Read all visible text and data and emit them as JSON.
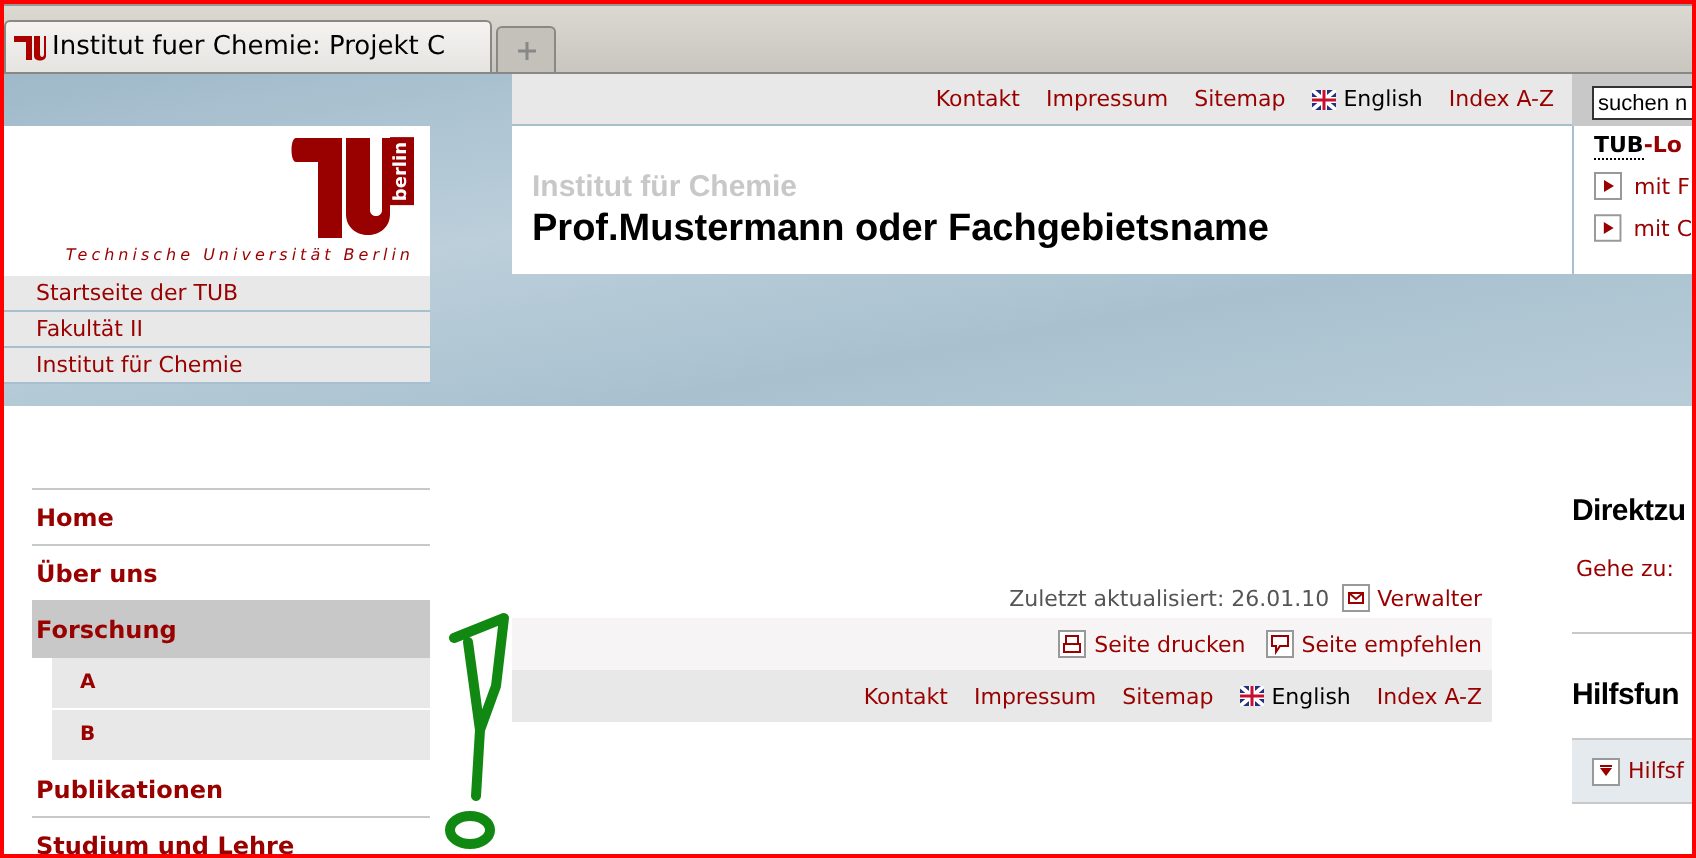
{
  "browser": {
    "tabs": [
      {
        "title": "Institut fuer Chemie: Projekt C",
        "selected": true
      }
    ]
  },
  "header": {
    "logo": {
      "side_text": "berlin",
      "caption": "Technische Universität Berlin"
    },
    "breadcrumbs": [
      "Startseite der TUB",
      "Fakultät II",
      "Institut für Chemie"
    ],
    "top_links": [
      {
        "label": "Kontakt",
        "kind": "link"
      },
      {
        "label": "Impressum",
        "kind": "link"
      },
      {
        "label": "Sitemap",
        "kind": "link"
      },
      {
        "label": "English",
        "kind": "language"
      },
      {
        "label": "Index A-Z",
        "kind": "link"
      }
    ],
    "search": {
      "value": "suchen n"
    },
    "subtitle": "Institut für Chemie",
    "title": "Prof.Mustermann oder Fachgebietsname",
    "login": {
      "abbr": "TUB",
      "rest": "-Lo",
      "links": [
        "mit F",
        "mit C"
      ]
    }
  },
  "nav": [
    {
      "label": "Home",
      "selected": false
    },
    {
      "label": "Über uns",
      "selected": false
    },
    {
      "label": "Forschung",
      "selected": true,
      "children": [
        {
          "label": "A",
          "selected": false
        },
        {
          "label": "B",
          "selected": false
        }
      ]
    },
    {
      "label": "Publikationen",
      "selected": false
    },
    {
      "label": "Studium und Lehre",
      "selected": false
    }
  ],
  "page_info": {
    "updated": "Zuletzt aktualisiert: 26.01.10",
    "maintainer": "Verwalter"
  },
  "actions": [
    {
      "label": "Seite drucken",
      "kind": "print"
    },
    {
      "label": "Seite empfehlen",
      "kind": "recommend"
    }
  ],
  "footer_links": [
    {
      "label": "Kontakt",
      "kind": "link"
    },
    {
      "label": "Impressum",
      "kind": "link"
    },
    {
      "label": "Sitemap",
      "kind": "link"
    },
    {
      "label": "English",
      "kind": "language"
    },
    {
      "label": "Index A-Z",
      "kind": "link"
    }
  ],
  "sidebar": {
    "direct_heading": "Direktzu",
    "goto_label": "Gehe zu:",
    "help_heading": "Hilfsfun",
    "help_toggle": "Hilfsf"
  }
}
